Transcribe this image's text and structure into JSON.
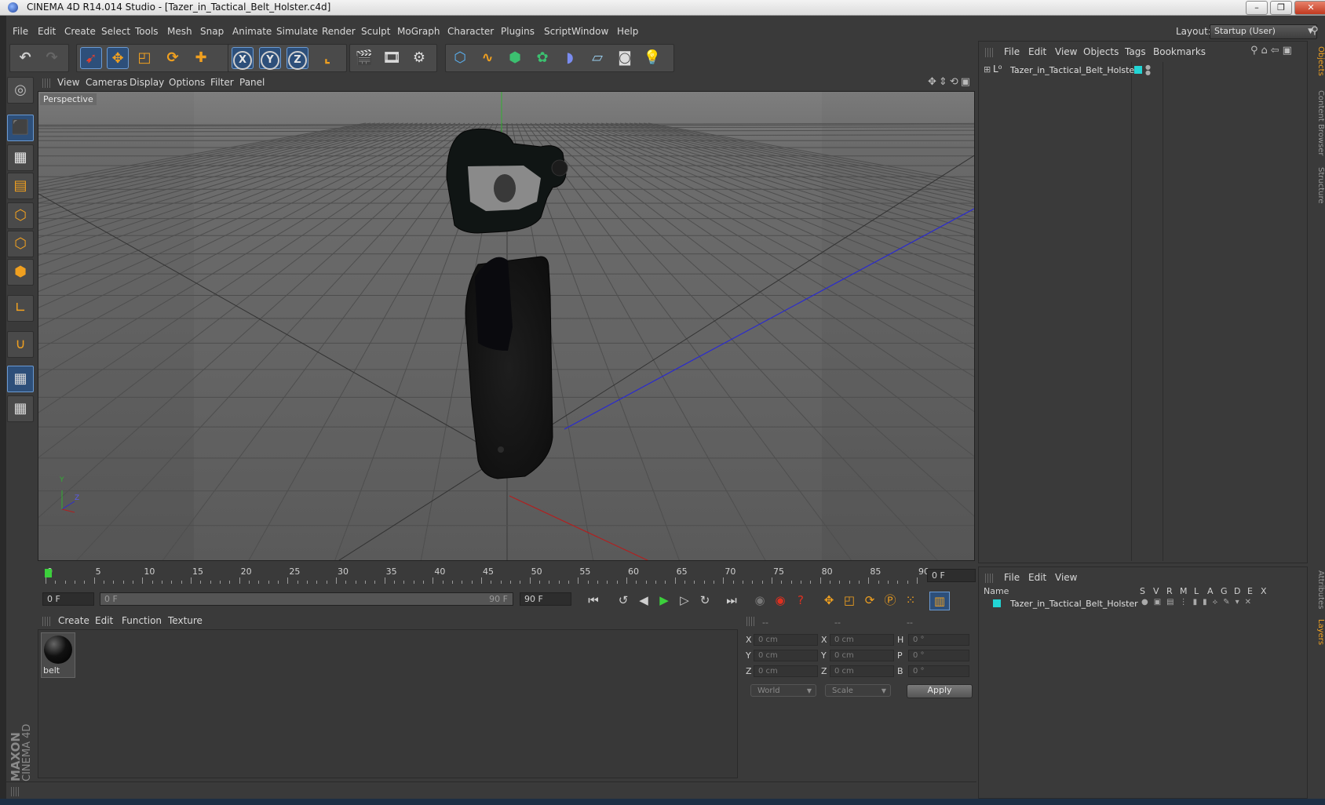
{
  "window": {
    "title": "CINEMA 4D R14.014 Studio - [Tazer_in_Tactical_Belt_Holster.c4d]",
    "min_icon": "minimize-icon",
    "max_icon": "maximize-icon",
    "close_icon": "close-icon"
  },
  "menubar": {
    "items": [
      "File",
      "Edit",
      "Create",
      "Select",
      "Tools",
      "Mesh",
      "Snap",
      "Animate",
      "Simulate",
      "Render",
      "Sculpt",
      "MoGraph",
      "Character",
      "Plugins",
      "Script",
      "Window",
      "Help"
    ],
    "layout_label": "Layout:",
    "layout_value": "Startup (User)"
  },
  "viewport": {
    "menu": [
      "View",
      "Cameras",
      "Display",
      "Options",
      "Filter",
      "Panel"
    ],
    "label": "Perspective",
    "axis_y": "Y",
    "axis_z": "Z"
  },
  "timeline": {
    "ticks": [
      "0",
      "5",
      "10",
      "15",
      "20",
      "25",
      "30",
      "35",
      "40",
      "45",
      "50",
      "55",
      "60",
      "65",
      "70",
      "75",
      "80",
      "85",
      "90"
    ],
    "current_frame": "0 F",
    "start_field": "0 F",
    "range_start": "0 F",
    "range_end": "90 F",
    "end_field": "90 F"
  },
  "material_manager": {
    "menu": [
      "Create",
      "Edit",
      "Function",
      "Texture"
    ],
    "materials": [
      {
        "name": "belt"
      }
    ]
  },
  "coordinates": {
    "headers": [
      "--",
      "--",
      "--"
    ],
    "rows": [
      {
        "a": "X",
        "a_val": "0 cm",
        "b": "X",
        "b_val": "0 cm",
        "c": "H",
        "c_val": "0 °"
      },
      {
        "a": "Y",
        "a_val": "0 cm",
        "b": "Y",
        "b_val": "0 cm",
        "c": "P",
        "c_val": "0 °"
      },
      {
        "a": "Z",
        "a_val": "0 cm",
        "b": "Z",
        "b_val": "0 cm",
        "c": "B",
        "c_val": "0 °"
      }
    ],
    "world_select": "World",
    "scale_select": "Scale",
    "apply": "Apply"
  },
  "object_manager": {
    "menu": [
      "File",
      "Edit",
      "View",
      "Objects",
      "Tags",
      "Bookmarks"
    ],
    "objects": [
      {
        "name": "Tazer_in_Tactical_Belt_Holster",
        "color": "#22d4d4"
      }
    ]
  },
  "layer_manager": {
    "menu": [
      "File",
      "Edit",
      "View"
    ],
    "columns": [
      "Name",
      "S",
      "V",
      "R",
      "M",
      "L",
      "A",
      "G",
      "D",
      "E",
      "X"
    ],
    "layers": [
      {
        "name": "Tazer_in_Tactical_Belt_Holster",
        "color": "#22d4d4"
      }
    ]
  },
  "side_tabs": [
    "Objects",
    "Content Browser",
    "Structure",
    "Attributes",
    "Layers"
  ],
  "brand": {
    "maxon": "MAXON",
    "cinema": "CINEMA 4D"
  },
  "colors": {
    "accent": "#f0a020",
    "selection": "#2d4f7a",
    "x_axis": "#b02020",
    "z_axis": "#2a2ad0",
    "y_axis": "#30b030"
  }
}
